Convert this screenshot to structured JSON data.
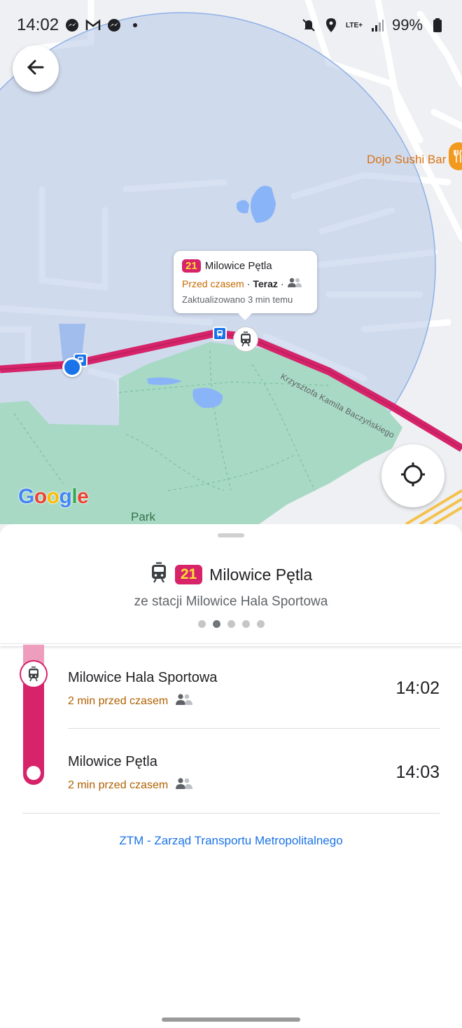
{
  "status_bar": {
    "time": "14:02",
    "network": "LTE+",
    "battery": "99%",
    "icons": [
      "messenger-icon",
      "gmail-icon",
      "messenger-icon",
      "dot-icon",
      "mute-icon",
      "location-icon",
      "signal-icon",
      "battery-icon"
    ]
  },
  "map": {
    "poi_label": "Dojo Sushi Bar",
    "street_label": "Krzysztofa Kamila Baczyńskiego",
    "park_label": "Park",
    "logo": "Google",
    "colors": {
      "route": "#d6236a",
      "park": "#a8d9c4",
      "radius": "#c7d7ef",
      "user": "#1a73e8"
    }
  },
  "info_bubble": {
    "line": "21",
    "destination": "Milowice Pętla",
    "status": "Przed czasem",
    "separator": "·",
    "when": "Teraz",
    "separator2": "·",
    "updated": "Zaktualizowano 3 min temu"
  },
  "sheet": {
    "line": "21",
    "destination": "Milowice Pętla",
    "subtitle": "ze stacji Milowice Hala Sportowa",
    "page_dots": 5,
    "active_dot": 1,
    "stops": [
      {
        "name": "Milowice Hala Sportowa",
        "status": "2 min przed czasem",
        "time": "14:02"
      },
      {
        "name": "Milowice Pętla",
        "status": "2 min przed czasem",
        "time": "14:03"
      }
    ],
    "agency": "ZTM - Zarząd Transportu Metropolitalnego"
  }
}
